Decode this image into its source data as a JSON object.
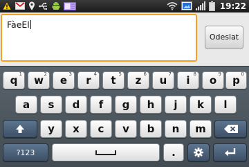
{
  "status_bar": {
    "left_icons": [
      "warning-icon",
      "gmail-icon",
      "location-pin-icon",
      "usb-icon",
      "android-icon",
      "sd-card-icon"
    ],
    "right_icons": [
      "wifi-icon",
      "screenshot-icon",
      "signal-icon",
      "battery-icon"
    ],
    "time": "19:22"
  },
  "compose": {
    "text": "FàeEl",
    "send_label": "Odeslat"
  },
  "keyboard": {
    "row1": [
      {
        "label": "q",
        "hint": "1"
      },
      {
        "label": "w",
        "hint": "2"
      },
      {
        "label": "e",
        "hint": "3"
      },
      {
        "label": "r",
        "hint": "4"
      },
      {
        "label": "t",
        "hint": "5"
      },
      {
        "label": "z",
        "hint": "6"
      },
      {
        "label": "u",
        "hint": "7"
      },
      {
        "label": "i",
        "hint": "8"
      },
      {
        "label": "o",
        "hint": "9"
      },
      {
        "label": "p",
        "hint": "0"
      }
    ],
    "row2": [
      "a",
      "s",
      "d",
      "f",
      "g",
      "h",
      "j",
      "k",
      "l"
    ],
    "row3": [
      "y",
      "x",
      "c",
      "v",
      "b",
      "n",
      "m"
    ],
    "numeric_label": "?123",
    "period_label": "."
  },
  "colors": {
    "focus_border": "#f3a21f",
    "function_key": "#4a6078",
    "keyboard_bg": "#4e5860"
  }
}
